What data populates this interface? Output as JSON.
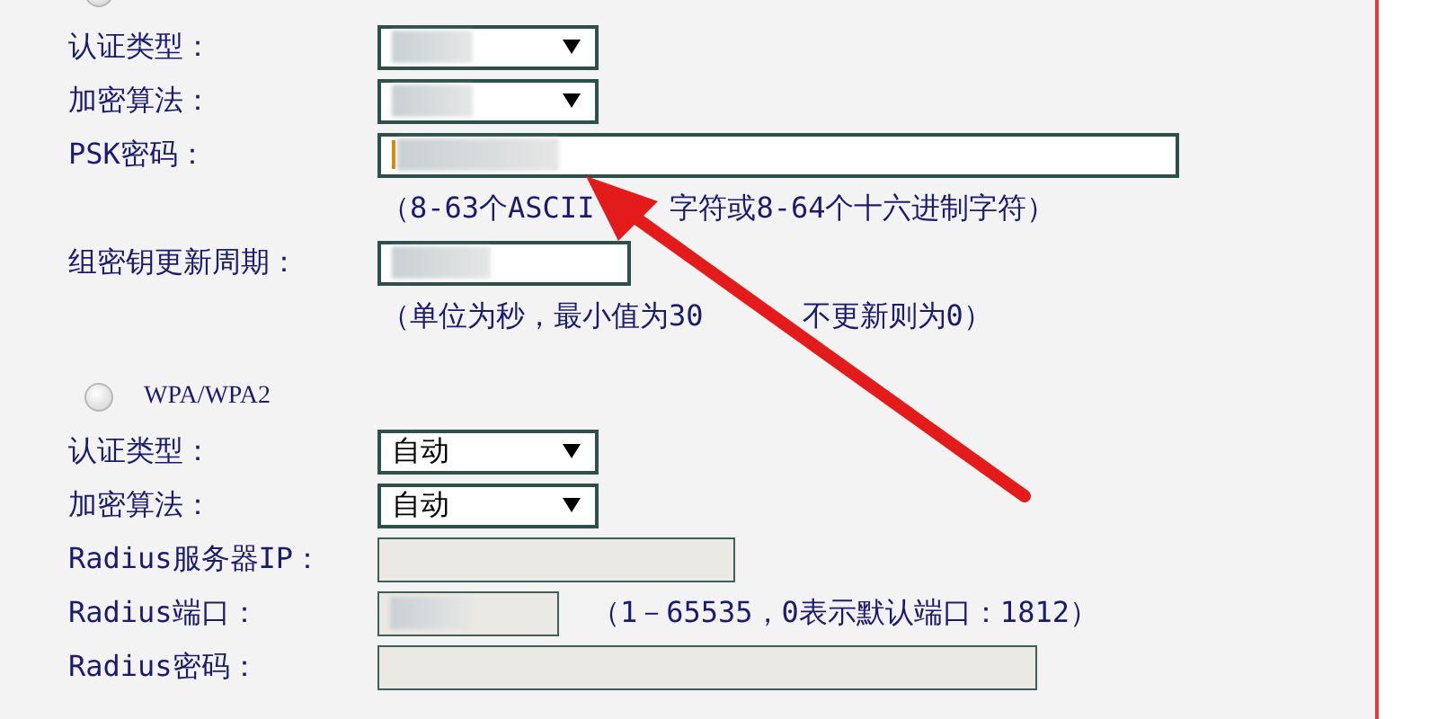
{
  "sections": [
    {
      "selected": false,
      "rows": [
        {
          "kind": "select",
          "label": "认证类型：",
          "redacted": true
        },
        {
          "kind": "select",
          "label": "加密算法：",
          "redacted": true
        },
        {
          "kind": "text",
          "label": "PSK密码：",
          "redacted": true,
          "disabled": false,
          "focused": true
        },
        {
          "kind": "hint",
          "parts": [
            "（8-63个ASCII",
            "字符或8-64个十六进制字符）"
          ]
        },
        {
          "kind": "text",
          "label": "组密钥更新周期：",
          "redacted": true,
          "disabled": false
        },
        {
          "kind": "hint",
          "parts": [
            "（单位为秒，最小值为30",
            "不更新则为0）"
          ]
        }
      ]
    },
    {
      "title": "WPA/WPA2",
      "selected": false,
      "rows": [
        {
          "kind": "select",
          "label": "认证类型：",
          "value": "自动"
        },
        {
          "kind": "select",
          "label": "加密算法：",
          "value": "自动"
        },
        {
          "kind": "text",
          "label": "Radius服务器IP：",
          "disabled": true
        },
        {
          "kind": "text",
          "label": "Radius端口：",
          "redacted": true,
          "disabled": true,
          "note": "（1－65535，0表示默认端口：1812）"
        },
        {
          "kind": "text",
          "label": "Radius密码：",
          "disabled": true
        }
      ]
    }
  ]
}
